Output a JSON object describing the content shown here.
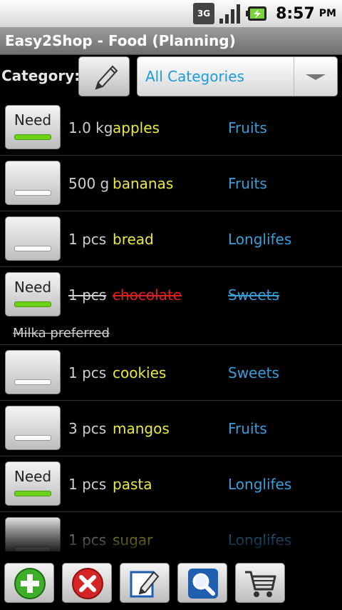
{
  "statusbar": {
    "network": "3G",
    "time": "8:57",
    "ampm": "PM"
  },
  "title": "Easy2Shop - Food (Planning)",
  "category": {
    "label": "Category:",
    "selected": "All Categories"
  },
  "items": [
    {
      "need": true,
      "need_label": "Need",
      "qty": "1.0 kg",
      "name": "apples",
      "category": "Fruits",
      "done": false
    },
    {
      "need": false,
      "need_label": "",
      "qty": "500 g",
      "name": "bananas",
      "category": "Fruits",
      "done": false
    },
    {
      "need": false,
      "need_label": "",
      "qty": "1 pcs",
      "name": "bread",
      "category": "Longlifes",
      "done": false
    },
    {
      "need": true,
      "need_label": "Need",
      "qty": "1 pcs",
      "name": "chocolate",
      "category": "Sweets",
      "done": true,
      "note": "Milka preferred"
    },
    {
      "need": false,
      "need_label": "",
      "qty": "1 pcs",
      "name": "cookies",
      "category": "Sweets",
      "done": false
    },
    {
      "need": false,
      "need_label": "",
      "qty": "3 pcs",
      "name": "mangos",
      "category": "Fruits",
      "done": false
    },
    {
      "need": true,
      "need_label": "Need",
      "qty": "1 pcs",
      "name": "pasta",
      "category": "Longlifes",
      "done": false
    },
    {
      "need": false,
      "need_label": "",
      "qty": "1 pcs",
      "name": "sugar",
      "category": "Longlifes",
      "done": false
    }
  ],
  "toolbar": [
    {
      "icon": "add-icon"
    },
    {
      "icon": "delete-icon"
    },
    {
      "icon": "edit-icon"
    },
    {
      "icon": "search-icon"
    },
    {
      "icon": "cart-icon"
    }
  ]
}
